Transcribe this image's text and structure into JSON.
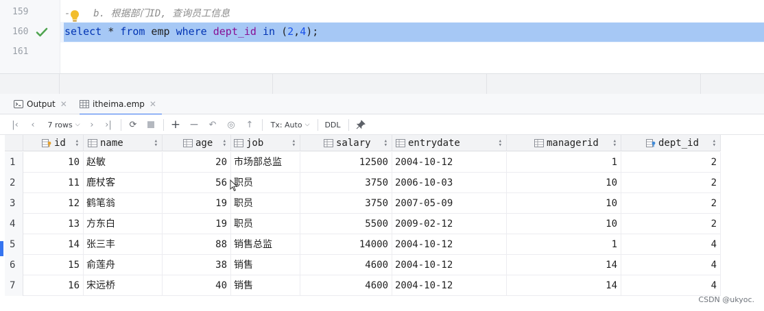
{
  "editor": {
    "line_numbers": [
      "159",
      "160",
      "161"
    ],
    "comment_prefix": "-",
    "comment_text": "b. 根据部门ID, 查询员工信息",
    "sql": {
      "t1": "select",
      "t2": " * ",
      "t3": "from",
      "t4": " emp ",
      "t5": "where",
      "t6": " ",
      "t7": "dept_id",
      "t8": " ",
      "t9": "in",
      "t10": " (",
      "t11": "2",
      "t12": ",",
      "t13": "4",
      "t14": ");"
    }
  },
  "tabs": [
    {
      "label": "Output",
      "icon": "console-icon"
    },
    {
      "label": "itheima.emp",
      "icon": "table-icon"
    }
  ],
  "toolbar": {
    "rows_label": "7 rows",
    "tx_label": "Tx: Auto",
    "ddl_label": "DDL"
  },
  "columns": [
    {
      "label": "id"
    },
    {
      "label": "name"
    },
    {
      "label": "age"
    },
    {
      "label": "job"
    },
    {
      "label": "salary"
    },
    {
      "label": "entrydate"
    },
    {
      "label": "managerid"
    },
    {
      "label": "dept_id"
    }
  ],
  "rows": [
    {
      "n": "1",
      "id": "10",
      "name": "赵敏",
      "age": "20",
      "job": "市场部总监",
      "salary": "12500",
      "entrydate": "2004-10-12",
      "managerid": "1",
      "dept_id": "2"
    },
    {
      "n": "2",
      "id": "11",
      "name": "鹿杖客",
      "age": "56",
      "job": "职员",
      "salary": "3750",
      "entrydate": "2006-10-03",
      "managerid": "10",
      "dept_id": "2"
    },
    {
      "n": "3",
      "id": "12",
      "name": "鹤笔翁",
      "age": "19",
      "job": "职员",
      "salary": "3750",
      "entrydate": "2007-05-09",
      "managerid": "10",
      "dept_id": "2"
    },
    {
      "n": "4",
      "id": "13",
      "name": "方东白",
      "age": "19",
      "job": "职员",
      "salary": "5500",
      "entrydate": "2009-02-12",
      "managerid": "10",
      "dept_id": "2"
    },
    {
      "n": "5",
      "id": "14",
      "name": "张三丰",
      "age": "88",
      "job": "销售总监",
      "salary": "14000",
      "entrydate": "2004-10-12",
      "managerid": "1",
      "dept_id": "4"
    },
    {
      "n": "6",
      "id": "15",
      "name": "俞莲舟",
      "age": "38",
      "job": "销售",
      "salary": "4600",
      "entrydate": "2004-10-12",
      "managerid": "14",
      "dept_id": "4"
    },
    {
      "n": "7",
      "id": "16",
      "name": "宋远桥",
      "age": "40",
      "job": "销售",
      "salary": "4600",
      "entrydate": "2004-10-12",
      "managerid": "14",
      "dept_id": "4"
    }
  ],
  "watermark": "CSDN @ukyoc."
}
